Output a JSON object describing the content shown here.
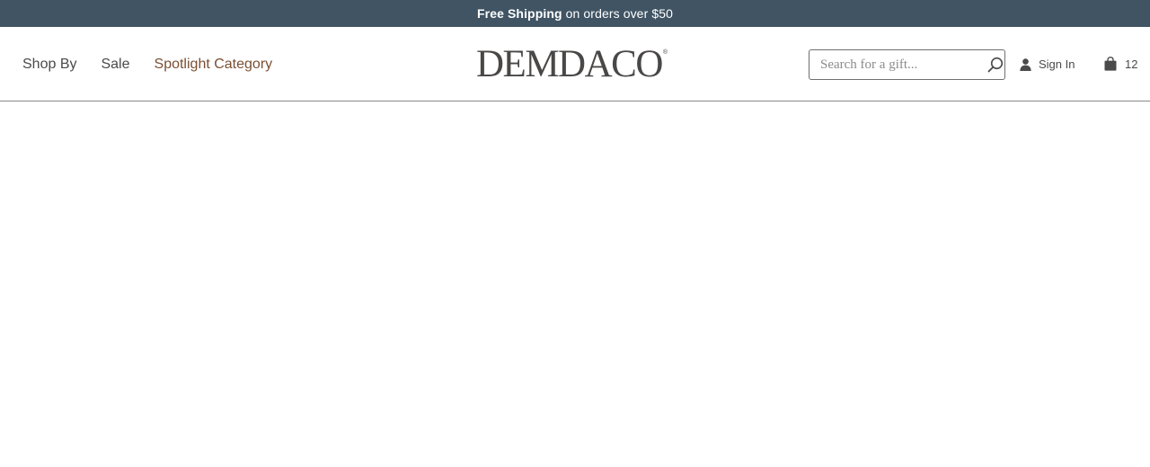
{
  "promo": {
    "bold": "Free Shipping",
    "rest": "on orders over $50"
  },
  "nav": {
    "items": [
      {
        "label": "Shop By"
      },
      {
        "label": "Sale"
      },
      {
        "label": "Spotlight Category"
      }
    ]
  },
  "logo": {
    "text": "DEMDACO",
    "mark": "®"
  },
  "search": {
    "placeholder": "Search for a gift...",
    "value": "",
    "icon": "search-icon"
  },
  "account": {
    "label": "Sign In",
    "icon": "user-icon"
  },
  "cart": {
    "count": "12",
    "icon": "shopping-bag-icon"
  },
  "colors": {
    "promo_bg": "#405464",
    "spotlight": "#7a4f33",
    "text": "#4a4a4a"
  }
}
